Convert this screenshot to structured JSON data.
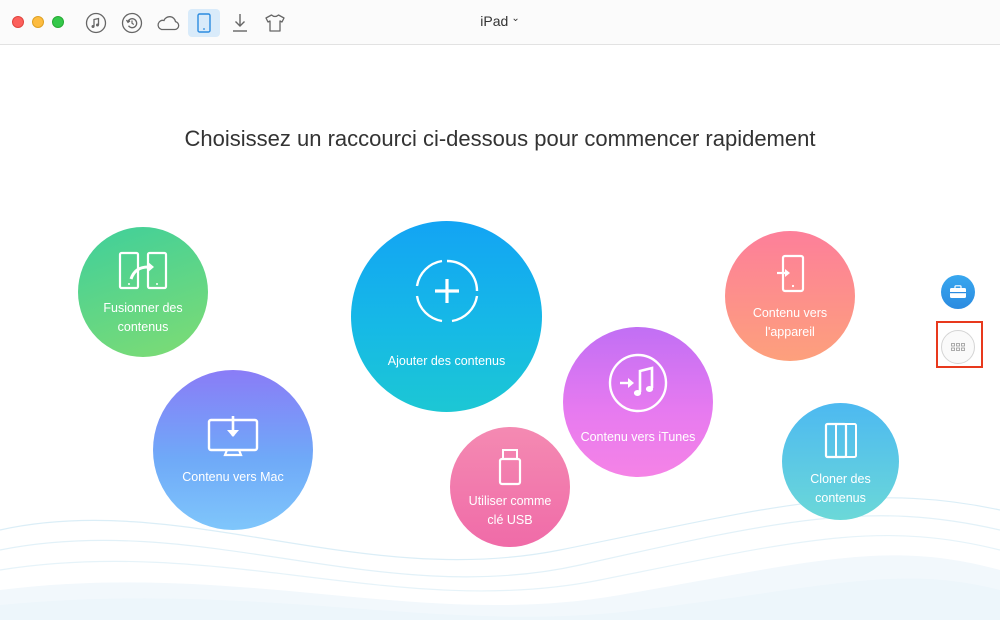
{
  "toolbar": {
    "icons": [
      "music-icon",
      "history-icon",
      "cloud-icon",
      "ipad-icon",
      "download-icon",
      "tshirt-icon"
    ],
    "active_icon": "ipad-icon"
  },
  "device": {
    "name": "iPad",
    "chevron": "⌄"
  },
  "headline": "Choisissez un raccourci ci-dessous pour commencer rapidement",
  "shortcuts": {
    "merge": {
      "label": "Fusionner des contenus",
      "icon": "merge-icon"
    },
    "mac": {
      "label": "Contenu vers Mac",
      "icon": "mac-icon"
    },
    "add": {
      "label": "Ajouter des contenus",
      "icon": "add-icon"
    },
    "usb": {
      "label": "Utiliser comme clé USB",
      "icon": "usb-icon"
    },
    "itunes": {
      "label": "Contenu vers iTunes",
      "icon": "itunes-icon"
    },
    "device": {
      "label": "Contenu vers l'appareil",
      "icon": "to-device-icon"
    },
    "clone": {
      "label": "Cloner des contenus",
      "icon": "clone-icon"
    }
  },
  "side": {
    "tools_icon": "toolbox-icon",
    "more_icon": "grid-icon"
  },
  "colors": {
    "accent": "#2b8be0",
    "highlight": "#e8391d",
    "active_tab": "#d9ebfa"
  }
}
